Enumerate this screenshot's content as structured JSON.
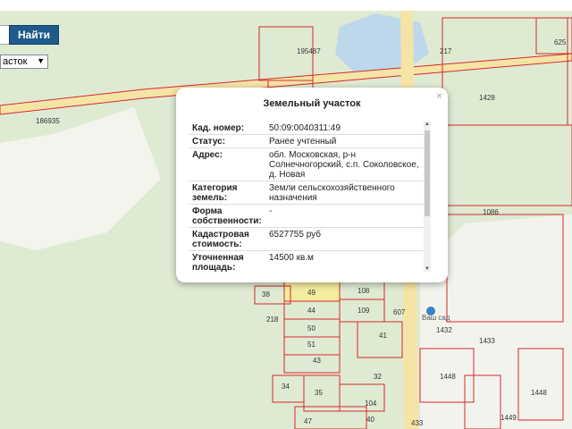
{
  "toolbar": {
    "find_label": "Найти",
    "object_type_value": "асток"
  },
  "popup": {
    "title": "Земельный участок",
    "rows": [
      {
        "label": "Кад. номер:",
        "value": "50:09:0040311:49"
      },
      {
        "label": "Статус:",
        "value": "Ранее учтенный"
      },
      {
        "label": "Адрес:",
        "value": "обл. Московская, р-н Солнечногорский, с.п. Соколовское, д. Новая"
      },
      {
        "label": "Категория земель:",
        "value": "Земли сельскохозяйственного назначения"
      },
      {
        "label": "Форма собственности:",
        "value": "-"
      },
      {
        "label": "Кадастровая стоимость:",
        "value": "6527755 руб"
      },
      {
        "label": "Уточненная площадь:",
        "value": "14500 кв.м"
      }
    ]
  },
  "map": {
    "road_label": "186935",
    "parcels": [
      "625",
      "1428",
      "1086",
      "108",
      "109",
      "607",
      "41",
      "38",
      "49",
      "44",
      "50",
      "51",
      "43",
      "32",
      "34",
      "35",
      "104",
      "40",
      "47",
      "433",
      "1432",
      "1433",
      "1448",
      "1448",
      "1449",
      "218",
      "217",
      "195487"
    ],
    "poi_label": "Ваш сад",
    "colors": {
      "forest": "#dde9cf",
      "field": "#f2f2ee",
      "parcel_line": "#d42a2a",
      "road": "#f0c84a",
      "water": "#bcd8ea",
      "highlight": "#f3ed9f"
    }
  }
}
